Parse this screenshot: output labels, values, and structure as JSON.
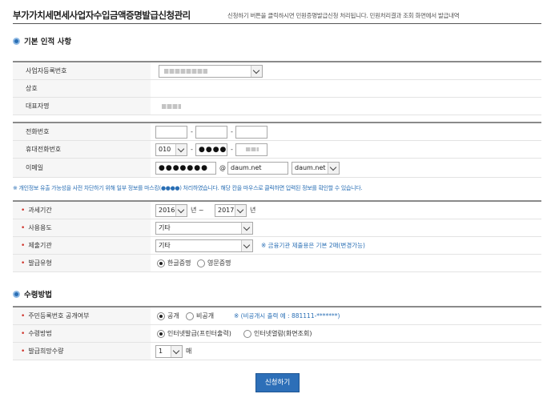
{
  "header": {
    "title": "부가가치세면세사업자수입금액증명발급신청관리",
    "description": "신청하기 버튼을 클릭하시면 민원증명발급신청 처리됩니다. 민원처리결과 조회 화면에서 발급내역"
  },
  "basic_section": {
    "title": "기본 인적 사항",
    "labels": {
      "biz_no": "사업자등록번호",
      "trade_name": "상호",
      "representative": "대표자명",
      "phone": "전화번호",
      "mobile": "휴대전화번호",
      "email": "이메일"
    },
    "mobile_prefix": "010",
    "mobile_middle": "●●●●",
    "email_local": "●●●●●●●",
    "email_at": "@",
    "email_domain": "daum.net",
    "email_domain_select": "daum.net",
    "dash": "-"
  },
  "notice": "※ 개인정보 유출 가능성을 사전 차단하기 위해 일부 정보를 마스킹(●●●●) 처리하였습니다. 해당 칸을 마우스로 클릭하면 입력된 정보를 확인할 수 있습니다.",
  "request_section": {
    "labels": {
      "period": "과세기간",
      "purpose": "사용용도",
      "institution": "제출기관",
      "issue_type": "발급유형"
    },
    "period_start": "2016",
    "period_start_unit": "년 ~",
    "period_end": "2017",
    "period_end_unit": "년",
    "purpose_value": "기타",
    "institution_value": "기타",
    "institution_note": "※ 금융기관 제출용은 기본 2매(변경가능)",
    "issue_type_korean": "한글증명",
    "issue_type_english": "영문증명"
  },
  "receive_section": {
    "title": "수령방법",
    "labels": {
      "disclosure": "주민등록번호 공개여부",
      "method": "수령방법",
      "copies": "발급희망수량"
    },
    "disclose_yes": "공개",
    "disclose_no": "비공개",
    "disclose_note": "※ (비공개시 출력 예 : 881111-*******)",
    "method_print": "인터넷발급(프린터출력)",
    "method_view": "인터넷열람(화면조회)",
    "copies_value": "1",
    "copies_unit": "매"
  },
  "submit_label": "신청하기",
  "colors": {
    "accent": "#2d6fb8",
    "required": "#d0342c",
    "note": "#2a6fb5"
  }
}
